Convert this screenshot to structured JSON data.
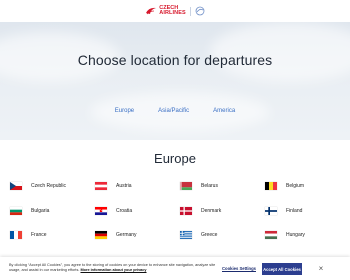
{
  "header": {
    "logo_line1": "CZECH",
    "logo_line2": "AIRLINES",
    "brand_color": "#d7192d"
  },
  "hero": {
    "title": "Choose location for departures",
    "tabs": [
      {
        "label": "Europe"
      },
      {
        "label": "Asia/Pacific"
      },
      {
        "label": "America"
      }
    ],
    "tab_color": "#3a6fc4"
  },
  "section": {
    "title": "Europe"
  },
  "countries": [
    {
      "name": "Czech Republic",
      "flag": "cz"
    },
    {
      "name": "Austria",
      "flag": "at"
    },
    {
      "name": "Belarus",
      "flag": "by"
    },
    {
      "name": "Belgium",
      "flag": "be"
    },
    {
      "name": "Bulgaria",
      "flag": "bg"
    },
    {
      "name": "Croatia",
      "flag": "hr"
    },
    {
      "name": "Denmark",
      "flag": "dk"
    },
    {
      "name": "Finland",
      "flag": "fi"
    },
    {
      "name": "France",
      "flag": "fr"
    },
    {
      "name": "Germany",
      "flag": "de"
    },
    {
      "name": "Greece",
      "flag": "gr"
    },
    {
      "name": "Hungary",
      "flag": "hu"
    }
  ],
  "cookie": {
    "text": "By clicking “Accept All Cookies”, you agree to the storing of cookies on your device to enhance site navigation, analyze site usage, and assist in our marketing efforts.",
    "more_link": "More information about your privacy",
    "settings_label": "Cookies Settings",
    "accept_label": "Accept All Cookies",
    "close_label": "×",
    "accept_color": "#2c3e8f"
  }
}
